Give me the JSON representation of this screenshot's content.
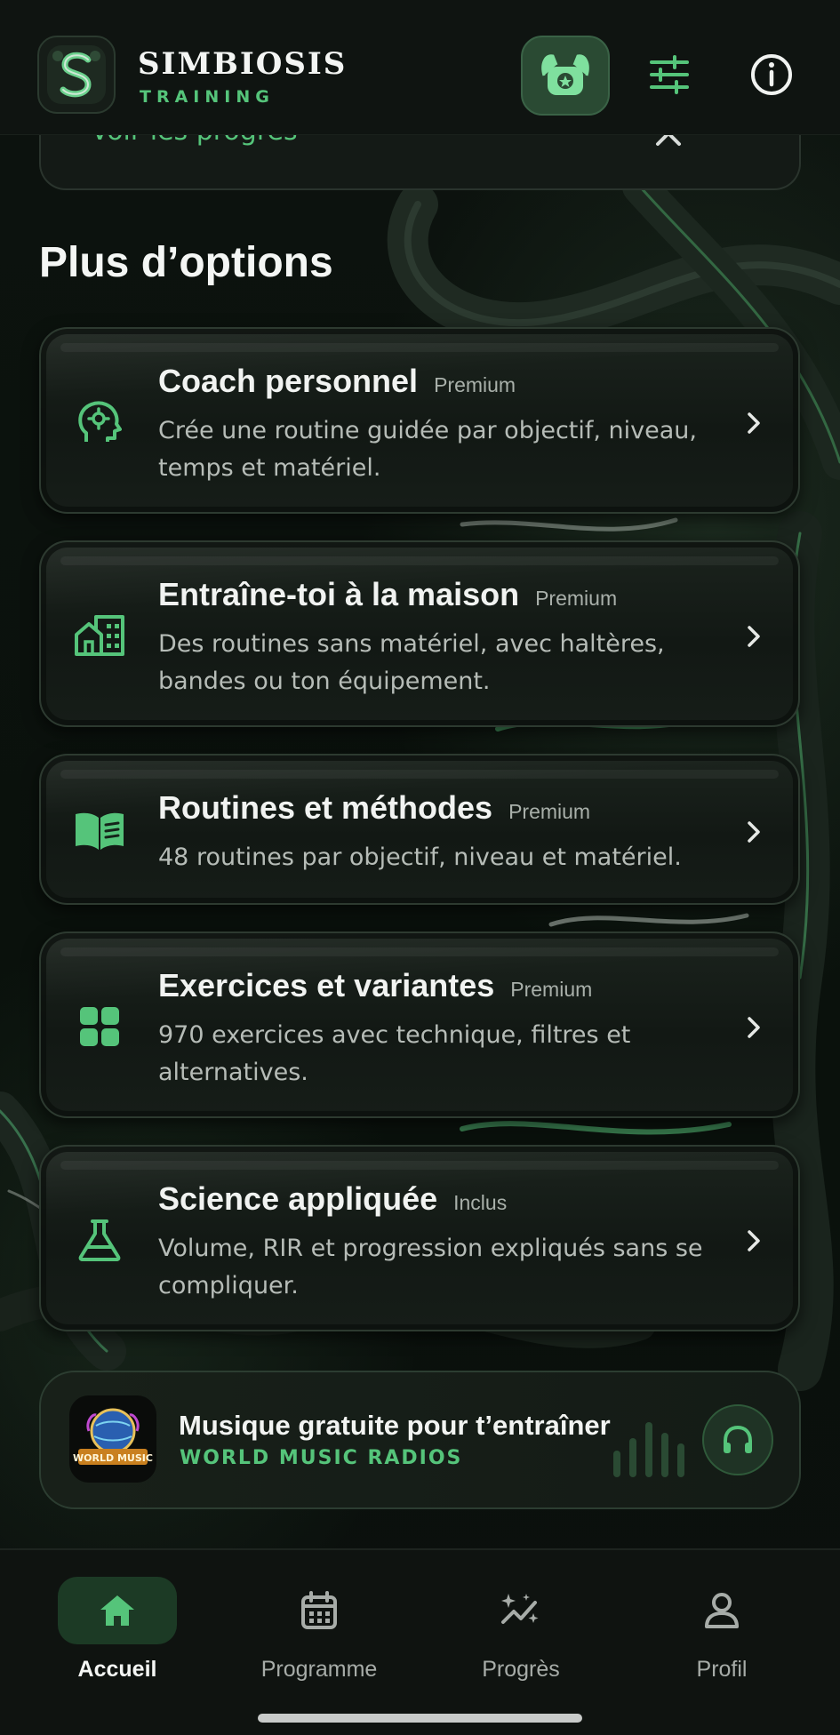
{
  "header": {
    "brand_name": "SIMBIOSIS",
    "brand_sub": "TRAINING",
    "icons": [
      "app-logo-icon",
      "trophy-badge-icon",
      "filter-sliders-icon",
      "info-icon"
    ]
  },
  "partial_card": {
    "link_text": "Voir les progrès",
    "close_icon": "close-icon"
  },
  "section": {
    "title": "Plus d’options"
  },
  "options": [
    {
      "title": "Coach personnel",
      "badge": "Premium",
      "description": "Crée une routine guidée par objectif, niveau, temps et matériel.",
      "icon": "brain-head-icon"
    },
    {
      "title": "Entraîne-toi à la maison",
      "badge": "Premium",
      "description": "Des routines sans matériel, avec haltères, bandes ou ton équipement.",
      "icon": "home-building-icon"
    },
    {
      "title": "Routines et méthodes",
      "badge": "Premium",
      "description": "48 routines par objectif, niveau et matériel.",
      "icon": "open-book-icon"
    },
    {
      "title": "Exercices et variantes",
      "badge": "Premium",
      "description": "970 exercices avec technique, filtres et alternatives.",
      "icon": "grid-icon"
    },
    {
      "title": "Science appliquée",
      "badge": "Inclus",
      "description": "Volume, RIR et progression expliqués sans se compliquer.",
      "icon": "flask-icon"
    }
  ],
  "music": {
    "title": "Musique gratuite pour t’entraîner",
    "subtitle": "WORLD MUSIC RADIOS",
    "logo_text": "WORLD MUSIC",
    "icon": "headphones-icon"
  },
  "nav": {
    "items": [
      {
        "label": "Accueil",
        "icon": "home-icon",
        "active": true
      },
      {
        "label": "Programme",
        "icon": "calendar-icon",
        "active": false
      },
      {
        "label": "Progrès",
        "icon": "sparkle-chart-icon",
        "active": false
      },
      {
        "label": "Profil",
        "icon": "user-icon",
        "active": false
      }
    ]
  },
  "colors": {
    "accent": "#55c47a",
    "background": "#0a0f0c",
    "card": "#141a16"
  }
}
